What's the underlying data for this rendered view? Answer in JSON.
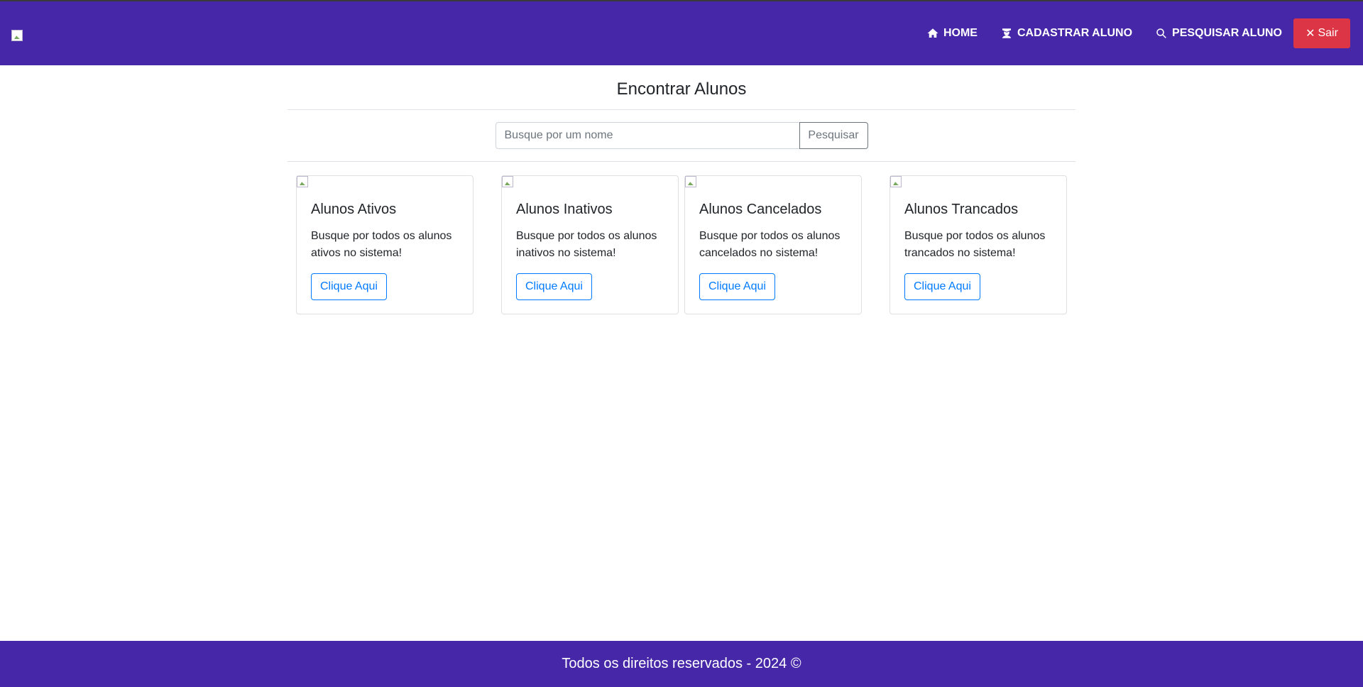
{
  "header": {
    "brand_icon": "broken-image-icon",
    "nav": [
      {
        "label": "HOME",
        "icon": "home-icon"
      },
      {
        "label": "CADASTRAR ALUNO",
        "icon": "user-graduate-icon"
      },
      {
        "label": "PESQUISAR ALUNO",
        "icon": "search-icon"
      }
    ],
    "logout_label": "Sair",
    "logout_icon": "close-icon"
  },
  "main": {
    "title": "Encontrar Alunos",
    "search": {
      "placeholder": "Busque por um nome",
      "value": "",
      "button_label": "Pesquisar"
    },
    "cards": [
      {
        "title": "Alunos Ativos",
        "text": "Busque por todos os alunos ativos no sistema!",
        "button_label": "Clique Aqui"
      },
      {
        "title": "Alunos Inativos",
        "text": "Busque por todos os alunos inativos no sistema!",
        "button_label": "Clique Aqui"
      },
      {
        "title": "Alunos Cancelados",
        "text": "Busque por todos os alunos cancelados no sistema!",
        "button_label": "Clique Aqui"
      },
      {
        "title": "Alunos Trancados",
        "text": "Busque por todos os alunos trancados no sistema!",
        "button_label": "Clique Aqui"
      }
    ]
  },
  "footer": {
    "text": "Todos os direitos reservados - 2024 ©"
  },
  "colors": {
    "primary": "#4527a8",
    "danger": "#dc3545",
    "link": "#007bff"
  }
}
